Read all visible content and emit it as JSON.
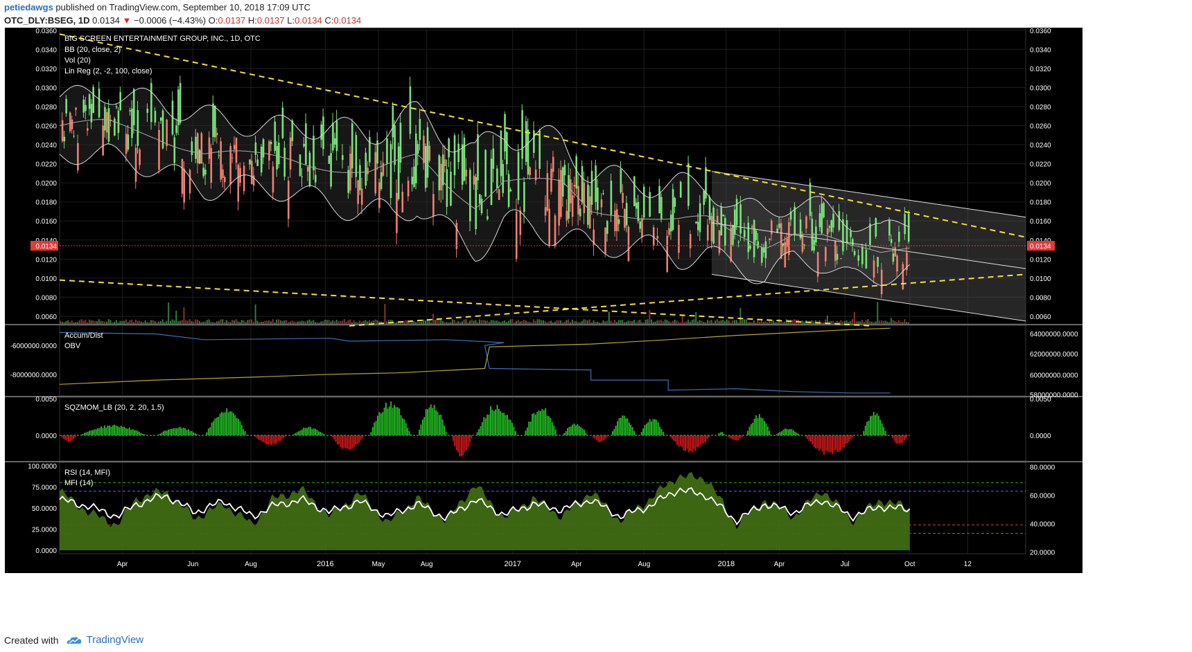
{
  "header": {
    "author": "petiedawgs",
    "published": "published on TradingView.com, September 10, 2018 17:09 UTC",
    "symbol": "OTC_DLY:BSEG, 1D",
    "last": "0.0134",
    "down_arrow": "▼",
    "change": "−0.0006 (−4.43%)",
    "o_label": "O:",
    "o_value": "0.0137",
    "h_label": "H:",
    "h_value": "0.0137",
    "l_label": "L:",
    "l_value": "0.0134",
    "c_label": "C:",
    "c_value": "0.0134"
  },
  "footer": {
    "created_with": "Created with",
    "brand": "TradingView",
    "logo_icon": "tradingview-cloud-icon"
  },
  "colors": {
    "background": "#000000",
    "up": "#7be37b",
    "down": "#f08070",
    "bb": "#d8d8d8",
    "trend": "#f5e23a",
    "adl": "#3d6fb8",
    "obv": "#b5a730",
    "mom_up": "#22c322",
    "mom_down": "#d01a1a",
    "rsi": "#ffffff",
    "mfi": "#3f6b12",
    "last_price_label": "#e53935"
  },
  "chart_data": [
    {
      "type": "line",
      "title": "BIG SCREEN ENTERTAINMENT GROUP, INC., 1D, OTC",
      "legend": [
        "BB (20, close, 2)",
        "Vol (20)",
        "Lin Reg (2, -2, 100, close)"
      ],
      "yticks": [
        "0.0360",
        "0.0340",
        "0.0320",
        "0.0300",
        "0.0280",
        "0.0260",
        "0.0240",
        "0.0220",
        "0.0200",
        "0.0180",
        "0.0160",
        "0.0140",
        "0.0120",
        "0.0100",
        "0.0080",
        "0.0060"
      ],
      "last_price": "0.0134",
      "ylim": [
        0.0052,
        0.0362
      ],
      "x_ticks": [
        "Apr",
        "Jun",
        "Aug",
        "2016",
        "May",
        "Aug",
        "2017",
        "Apr",
        "Aug",
        "2018",
        "Apr",
        "Jul",
        "Oct",
        "12"
      ],
      "price_path": {
        "t": [
          0.0,
          0.05,
          0.1,
          0.15,
          0.2,
          0.24,
          0.28,
          0.32,
          0.345,
          0.37,
          0.4,
          0.43,
          0.46,
          0.49,
          0.52,
          0.55,
          0.58,
          0.61,
          0.64,
          0.67,
          0.7,
          0.73,
          0.76,
          0.79,
          0.82,
          0.85,
          0.88
        ],
        "mid": [
          0.026,
          0.0262,
          0.025,
          0.0232,
          0.0228,
          0.0225,
          0.0218,
          0.021,
          0.0215,
          0.0225,
          0.02,
          0.018,
          0.0205,
          0.02,
          0.0195,
          0.017,
          0.017,
          0.0165,
          0.016,
          0.016,
          0.0145,
          0.0135,
          0.015,
          0.0145,
          0.013,
          0.0125,
          0.0134
        ],
        "amp": [
          0.003,
          0.0032,
          0.0035,
          0.0038,
          0.003,
          0.0035,
          0.004,
          0.004,
          0.005,
          0.0045,
          0.0055,
          0.0048,
          0.005,
          0.0045,
          0.0048,
          0.004,
          0.0035,
          0.003,
          0.0038,
          0.0036,
          0.003,
          0.0035,
          0.0028,
          0.003,
          0.003,
          0.0025,
          0.0025
        ]
      },
      "trendlines": [
        {
          "from": [
            0.0,
            0.0356
          ],
          "to": [
            1.0,
            0.0143
          ]
        },
        {
          "from": [
            0.0,
            0.0098
          ],
          "to": [
            0.84,
            0.005
          ]
        },
        {
          "from": [
            0.3,
            0.005
          ],
          "to": [
            1.0,
            0.0104
          ]
        }
      ],
      "linreg": {
        "t0": 0.675,
        "t1": 1.0,
        "mid0": 0.0158,
        "mid1": 0.011,
        "upper0": 0.0212,
        "upper1": 0.0164,
        "lower0": 0.0104,
        "lower1": 0.0055
      }
    },
    {
      "type": "line",
      "title": "Accum/Dist",
      "legend": [
        "Accum/Dist",
        "OBV"
      ],
      "left_ticks": [
        "-6000000.0000",
        "-8000000.0000"
      ],
      "right_ticks": [
        "64000000.0000",
        "62000000.0000",
        "60000000.0000",
        "58000000.0000"
      ],
      "adl": {
        "t": [
          0.0,
          0.1,
          0.15,
          0.28,
          0.3,
          0.4,
          0.46,
          0.44,
          0.445,
          0.55,
          0.55,
          0.63,
          0.63,
          0.7,
          0.76,
          0.82,
          0.86
        ],
        "v": [
          -5.1,
          -5.2,
          -5.6,
          -5.5,
          -5.7,
          -5.6,
          -5.8,
          -6.0,
          -7.6,
          -7.7,
          -8.4,
          -8.4,
          -9.1,
          -9.0,
          -9.2,
          -9.3,
          -9.3
        ]
      },
      "obv": {
        "t": [
          0.0,
          0.1,
          0.2,
          0.28,
          0.35,
          0.44,
          0.445,
          0.55,
          0.63,
          0.7,
          0.76,
          0.82,
          0.86
        ],
        "v": [
          -8.7,
          -8.4,
          -8.2,
          -8.0,
          -7.9,
          -7.6,
          -6.1,
          -5.9,
          -5.6,
          -5.3,
          -5.1,
          -4.9,
          -4.8
        ]
      }
    },
    {
      "type": "bar",
      "title": "SQZMOM_LB (20, 2, 20, 1.5)",
      "yticks": [
        "0.0050",
        "0.0000"
      ],
      "ylim": [
        -0.0035,
        0.0052
      ],
      "cycles": [
        {
          "t0": 0.0,
          "t1": 0.02,
          "peak": -0.001
        },
        {
          "t0": 0.02,
          "t1": 0.1,
          "peak": 0.0015
        },
        {
          "t0": 0.1,
          "t1": 0.15,
          "peak": 0.0012
        },
        {
          "t0": 0.15,
          "t1": 0.2,
          "peak": 0.0038
        },
        {
          "t0": 0.2,
          "t1": 0.24,
          "peak": -0.0014
        },
        {
          "t0": 0.24,
          "t1": 0.28,
          "peak": 0.0012
        },
        {
          "t0": 0.28,
          "t1": 0.32,
          "peak": -0.0022
        },
        {
          "t0": 0.32,
          "t1": 0.37,
          "peak": 0.0048
        },
        {
          "t0": 0.37,
          "t1": 0.405,
          "peak": 0.0048
        },
        {
          "t0": 0.405,
          "t1": 0.43,
          "peak": -0.0032
        },
        {
          "t0": 0.43,
          "t1": 0.48,
          "peak": 0.0045
        },
        {
          "t0": 0.48,
          "t1": 0.52,
          "peak": 0.0042
        },
        {
          "t0": 0.52,
          "t1": 0.55,
          "peak": 0.0018
        },
        {
          "t0": 0.55,
          "t1": 0.57,
          "peak": -0.001
        },
        {
          "t0": 0.57,
          "t1": 0.6,
          "peak": 0.0028
        },
        {
          "t0": 0.6,
          "t1": 0.63,
          "peak": 0.0025
        },
        {
          "t0": 0.63,
          "t1": 0.68,
          "peak": -0.0024
        },
        {
          "t0": 0.68,
          "t1": 0.69,
          "peak": 0.0005
        },
        {
          "t0": 0.69,
          "t1": 0.71,
          "peak": -0.0008
        },
        {
          "t0": 0.71,
          "t1": 0.74,
          "peak": 0.003
        },
        {
          "t0": 0.74,
          "t1": 0.77,
          "peak": 0.001
        },
        {
          "t0": 0.77,
          "t1": 0.83,
          "peak": -0.0028
        },
        {
          "t0": 0.83,
          "t1": 0.86,
          "peak": 0.0034
        },
        {
          "t0": 0.86,
          "t1": 0.88,
          "peak": -0.0014
        }
      ]
    },
    {
      "type": "area",
      "title": "RSI (14, MFI)",
      "legend": [
        "RSI (14, MFI)",
        "MFI (14)"
      ],
      "left_ticks": [
        "100.0000",
        "75.0000",
        "50.0000",
        "25.0000",
        "0.0000"
      ],
      "right_ticks": [
        "80.0000",
        "60.0000",
        "40.0000",
        "20.0000"
      ],
      "ylim": [
        0,
        100
      ],
      "rsi": {
        "t": [
          0.0,
          0.03,
          0.06,
          0.08,
          0.11,
          0.14,
          0.17,
          0.2,
          0.22,
          0.25,
          0.28,
          0.31,
          0.34,
          0.37,
          0.4,
          0.43,
          0.46,
          0.49,
          0.52,
          0.55,
          0.58,
          0.61,
          0.64,
          0.67,
          0.7,
          0.73,
          0.76,
          0.79,
          0.82,
          0.85,
          0.88
        ],
        "v": [
          60,
          52,
          40,
          55,
          65,
          45,
          58,
          40,
          52,
          60,
          45,
          58,
          40,
          55,
          38,
          60,
          42,
          55,
          48,
          60,
          40,
          52,
          72,
          65,
          35,
          55,
          45,
          60,
          40,
          52,
          48
        ]
      },
      "mfi": {
        "t": [
          0.0,
          0.03,
          0.06,
          0.08,
          0.11,
          0.14,
          0.17,
          0.2,
          0.22,
          0.25,
          0.28,
          0.31,
          0.34,
          0.37,
          0.4,
          0.43,
          0.46,
          0.49,
          0.52,
          0.55,
          0.58,
          0.61,
          0.64,
          0.67,
          0.7,
          0.73,
          0.76,
          0.79,
          0.82,
          0.85,
          0.88
        ],
        "v": [
          70,
          45,
          30,
          62,
          70,
          38,
          55,
          30,
          60,
          72,
          40,
          68,
          32,
          62,
          35,
          78,
          38,
          62,
          40,
          70,
          35,
          60,
          88,
          85,
          30,
          60,
          40,
          72,
          35,
          60,
          50
        ]
      },
      "hlines": [
        {
          "v": 80,
          "color": "#22aa22"
        },
        {
          "v": 70,
          "color": "#4466ff"
        },
        {
          "v": 30,
          "color": "#e53935"
        },
        {
          "v": 20,
          "color": "#22aa22"
        }
      ]
    }
  ]
}
